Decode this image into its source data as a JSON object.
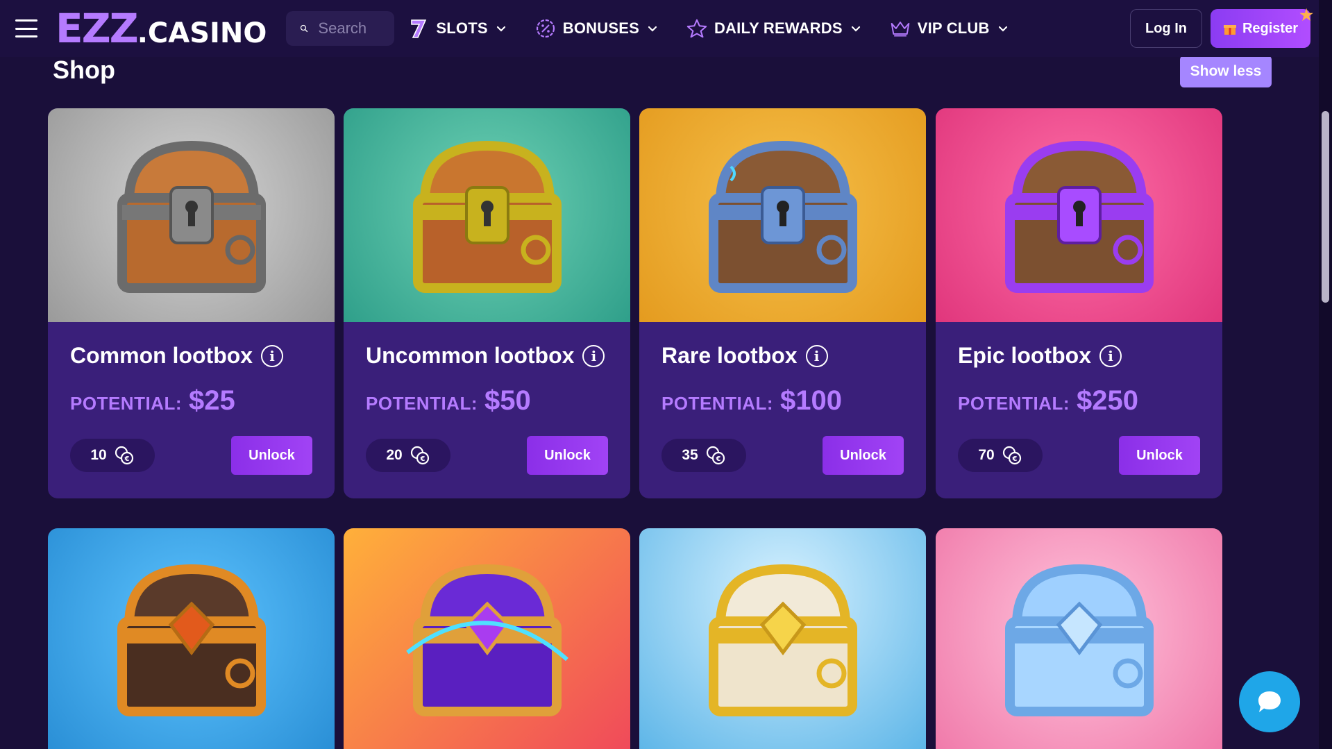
{
  "header": {
    "logo_main": "EZZ",
    "logo_suffix": ".CASINO",
    "search_placeholder": "Search",
    "nav": [
      {
        "label": "SLOTS",
        "icon": "seven-icon"
      },
      {
        "label": "BONUSES",
        "icon": "percent-badge-icon"
      },
      {
        "label": "DAILY REWARDS",
        "icon": "star-icon"
      },
      {
        "label": "VIP CLUB",
        "icon": "crown-icon"
      }
    ],
    "login_label": "Log In",
    "register_label": "Register"
  },
  "shop": {
    "title": "Shop",
    "show_less_label": "Show less",
    "potential_label": "POTENTIAL:",
    "unlock_label": "Unlock",
    "cards": [
      {
        "name": "Common lootbox",
        "potential": "$25",
        "cost": "10"
      },
      {
        "name": "Uncommon lootbox",
        "potential": "$50",
        "cost": "20"
      },
      {
        "name": "Rare lootbox",
        "potential": "$100",
        "cost": "35"
      },
      {
        "name": "Epic lootbox",
        "potential": "$250",
        "cost": "70"
      }
    ]
  },
  "colors": {
    "background": "#1a0f3a",
    "accent": "#b57bff",
    "button": "#9b3cf2",
    "chat": "#1fa6e8"
  }
}
